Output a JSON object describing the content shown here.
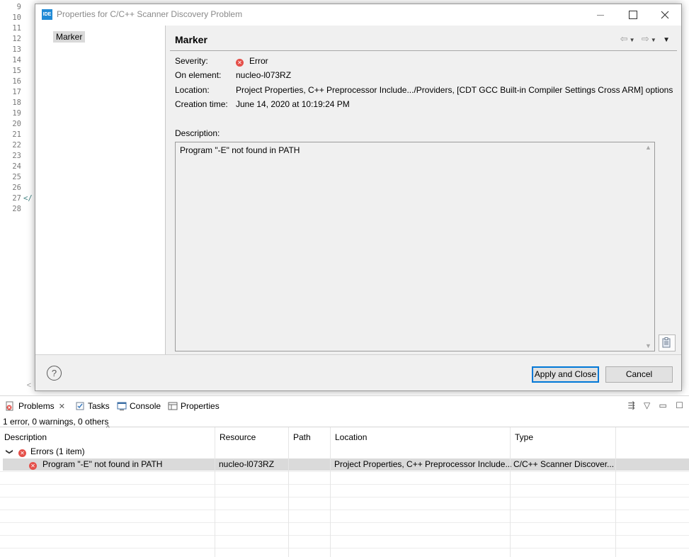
{
  "editor": {
    "line_numbers": [
      "9",
      "10",
      "11",
      "12",
      "13",
      "14",
      "15",
      "16",
      "17",
      "18",
      "19",
      "20",
      "21",
      "22",
      "23",
      "24",
      "25",
      "26",
      "27",
      "28"
    ],
    "code_fragment": "</",
    "scroll_left_glyph": "<"
  },
  "dialog": {
    "app_icon": "IDE",
    "title": "Properties for C/C++ Scanner Discovery Problem",
    "nav_item": "Marker",
    "page_title": "Marker",
    "properties": [
      {
        "label": "Severity:",
        "value": "Error",
        "icon": "error-icon"
      },
      {
        "label": "On element:",
        "value": "nucleo-l073RZ"
      },
      {
        "label": "Location:",
        "value": "Project Properties, C++ Preprocessor Include.../Providers, [CDT GCC Built-in Compiler Settings Cross ARM] options"
      },
      {
        "label": "Creation time:",
        "value": "June 14, 2020 at 10:19:24 PM"
      }
    ],
    "description_label": "Description:",
    "description_text": "Program \"-E\" not found in PATH",
    "help_glyph": "?",
    "apply_label": "Apply and Close",
    "cancel_label": "Cancel"
  },
  "problems_view": {
    "tabs": [
      {
        "label": "Problems",
        "icon": "problems-icon",
        "active": true
      },
      {
        "label": "Tasks",
        "icon": "tasks-icon"
      },
      {
        "label": "Console",
        "icon": "console-icon"
      },
      {
        "label": "Properties",
        "icon": "properties-icon"
      }
    ],
    "summary": "1 error, 0 warnings, 0 others",
    "columns": [
      "Description",
      "Resource",
      "Path",
      "Location",
      "Type"
    ],
    "group": {
      "label": "Errors (1 item)",
      "expanded": true
    },
    "rows": [
      {
        "description": "Program \"-E\" not found in PATH",
        "resource": "nucleo-l073RZ",
        "path": "",
        "location": "Project Properties, C++ Preprocessor Include...",
        "type": "C/C++ Scanner Discover..."
      }
    ]
  },
  "colors": {
    "error": "#e5504a",
    "focus": "#0078d7",
    "selection": "#dadada"
  }
}
